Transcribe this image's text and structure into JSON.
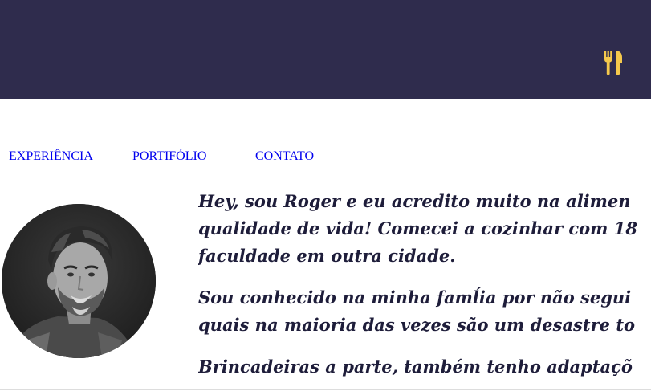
{
  "header": {
    "icon": "fork-knife-icon",
    "background_color": "#2f2c4d",
    "icon_color": "#f5c94c"
  },
  "nav": {
    "items": [
      {
        "label": "EXPERIÊNCIA"
      },
      {
        "label": "PORTIFÓLIO"
      },
      {
        "label": "CONTATO"
      }
    ]
  },
  "profile": {
    "avatar": "profile-photo"
  },
  "about": {
    "paragraphs": [
      [
        "Hey, sou Roger e eu acredito muito na alimen",
        "qualidade de vida! Comecei a cozinhar com 18",
        "faculdade em outra cidade."
      ],
      [
        "Sou conhecido na minha famĺia por não segui",
        "quais na maioria das vezes são um desastre to"
      ],
      [
        "Brincadeiras a parte, também tenho adaptaçõ"
      ]
    ]
  }
}
